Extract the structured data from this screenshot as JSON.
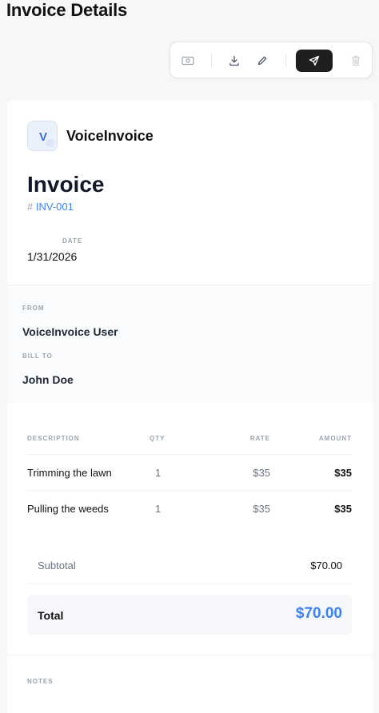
{
  "page": {
    "title": "Invoice Details"
  },
  "toolbar": {
    "icons": [
      "money-icon",
      "download-icon",
      "edit-icon",
      "send-icon",
      "trash-icon"
    ],
    "send_bg": "#1f1f1f"
  },
  "brand": {
    "logo_letter": "V",
    "name": "VoiceInvoice"
  },
  "invoice": {
    "title": "Invoice",
    "hash": "#",
    "number": "INV-001",
    "date_label": "DATE",
    "date": "1/31/2026"
  },
  "parties": {
    "from_label": "FROM",
    "from_name": "VoiceInvoice User",
    "bill_to_label": "BILL TO",
    "bill_to_name": "John Doe"
  },
  "table": {
    "headers": {
      "description": "DESCRIPTION",
      "qty": "QTY",
      "rate": "RATE",
      "amount": "AMOUNT"
    },
    "rows": [
      {
        "description": "Trimming the lawn",
        "qty": "1",
        "rate": "$35",
        "amount": "$35"
      },
      {
        "description": "Pulling the weeds",
        "qty": "1",
        "rate": "$35",
        "amount": "$35"
      }
    ]
  },
  "totals": {
    "subtotal_label": "Subtotal",
    "subtotal": "$70.00",
    "total_label": "Total",
    "total": "$70.00"
  },
  "notes": {
    "label": "NOTES"
  },
  "colors": {
    "accent": "#3b82f6",
    "dark": "#1f1f1f"
  }
}
